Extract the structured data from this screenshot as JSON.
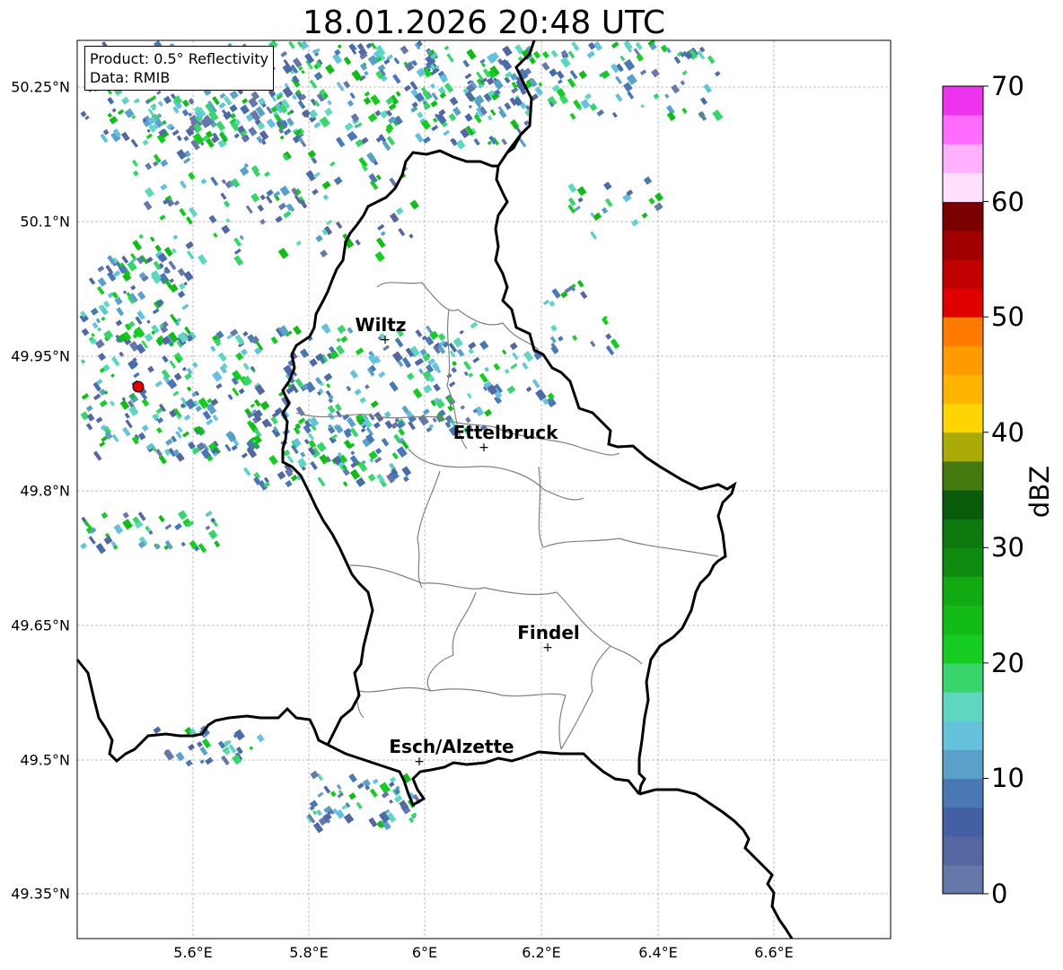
{
  "title": "18.01.2026 20:48 UTC",
  "info": {
    "product": "Product: 0.5° Reflectivity",
    "data": "Data: RMIB"
  },
  "axes": {
    "lat_ticks": [
      "50.25°N",
      "50.1°N",
      "49.95°N",
      "49.8°N",
      "49.65°N",
      "49.5°N",
      "49.35°N"
    ],
    "lon_ticks": [
      "5.6°E",
      "5.8°E",
      "6°E",
      "6.2°E",
      "6.4°E",
      "6.6°E"
    ]
  },
  "colorbar": {
    "label": "dBZ",
    "ticks": [
      "0",
      "10",
      "20",
      "30",
      "40",
      "50",
      "60",
      "70"
    ],
    "colors": [
      "#6677aa",
      "#5566a0",
      "#4460a4",
      "#4a78b4",
      "#5aa0c8",
      "#66c2dc",
      "#5fd6c0",
      "#3ad46c",
      "#16cc22",
      "#12bb18",
      "#11aa12",
      "#0e8a0e",
      "#0d780e",
      "#0a5a0c",
      "#447a10",
      "#aaaa08",
      "#ffd400",
      "#ffb400",
      "#ff9a00",
      "#ff7a00",
      "#e00000",
      "#c00000",
      "#a00000",
      "#7a0000",
      "#ffe0ff",
      "#ffb0ff",
      "#ff6cff",
      "#ee33ee"
    ]
  },
  "cities": [
    {
      "name": "Wiltz"
    },
    {
      "name": "Ettelbruck"
    },
    {
      "name": "Findel"
    },
    {
      "name": "Esch/Alzette"
    }
  ],
  "style": {
    "border_color": "#000000",
    "canton_color": "#808080",
    "grid_color": "#b0b0b0",
    "radar_site_color": "#e00000"
  }
}
